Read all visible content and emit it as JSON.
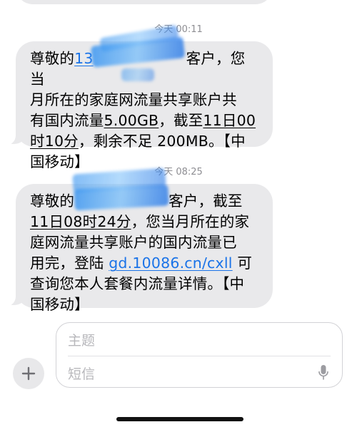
{
  "messages": [
    {
      "timestamp_day": "今天",
      "timestamp_time": "00:11",
      "lines": [
        [
          "尊敬的",
          "13",
          "",
          "客户，您当"
        ],
        [
          "月所在的家庭",
          "网",
          "流量共享账户共"
        ],
        [
          "有国内流量",
          "5.00GB",
          "，截至",
          "11日00"
        ],
        [
          "时10分",
          "，剩余不足 200MB。【中"
        ],
        [
          "国移动】"
        ]
      ]
    },
    {
      "timestamp_day": "今天",
      "timestamp_time": "08:25",
      "lines": [
        [
          "尊敬的",
          "",
          "客户，截至"
        ],
        [
          "11日08时24分",
          "，您当月所在的家"
        ],
        [
          "庭网流量共享账户的国内流量已"
        ],
        [
          "用完，登陆 ",
          "gd.10086.cn/cxll",
          " 可"
        ],
        [
          "查询您本人套餐内流量详情。【中"
        ],
        [
          "国移动】"
        ]
      ]
    }
  ],
  "compose": {
    "subject_placeholder": "主题",
    "body_placeholder": "短信"
  },
  "colors": {
    "bubble_gray": "#e9e9eb",
    "link_blue": "#1a73e8",
    "timestamp_gray": "#8e8e93",
    "placeholder_gray": "#b7b7bb"
  },
  "icons": {
    "add": "plus-icon",
    "voice": "microphone-icon"
  }
}
